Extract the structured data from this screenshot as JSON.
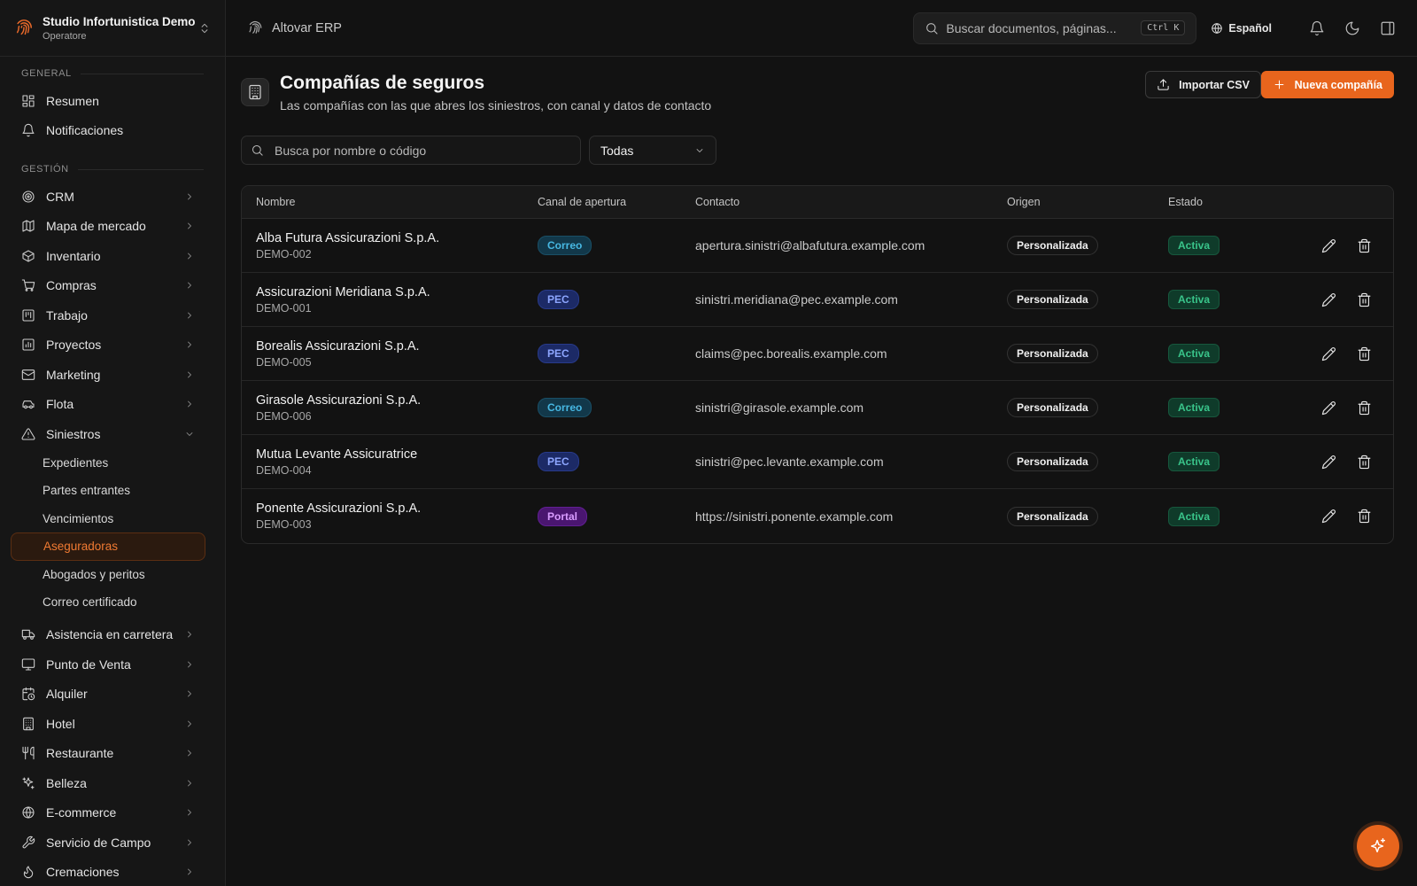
{
  "workspace": {
    "name": "Studio Infortunistica Demo",
    "role": "Operatore"
  },
  "topbar": {
    "app_title": "Altovar ERP",
    "search_placeholder": "Buscar documentos, páginas...",
    "shortcut": "Ctrl K",
    "language": "Español"
  },
  "sidebar": {
    "sections": [
      {
        "label": "GENERAL"
      },
      {
        "label": "GESTIÓN"
      }
    ],
    "general_items": [
      {
        "label": "Resumen",
        "icon": "dashboard-icon"
      },
      {
        "label": "Notificaciones",
        "icon": "bell-icon"
      }
    ],
    "gestion_items": [
      {
        "label": "CRM",
        "icon": "target-icon"
      },
      {
        "label": "Mapa de mercado",
        "icon": "map-icon"
      },
      {
        "label": "Inventario",
        "icon": "box-icon"
      },
      {
        "label": "Compras",
        "icon": "cart-icon"
      },
      {
        "label": "Trabajo",
        "icon": "kanban-icon"
      },
      {
        "label": "Proyectos",
        "icon": "chart-icon"
      },
      {
        "label": "Marketing",
        "icon": "mail-icon"
      },
      {
        "label": "Flota",
        "icon": "car-icon"
      },
      {
        "label": "Siniestros",
        "icon": "warning-icon"
      }
    ],
    "siniestros_sub": [
      {
        "label": "Expedientes"
      },
      {
        "label": "Partes entrantes"
      },
      {
        "label": "Vencimientos"
      },
      {
        "label": "Aseguradoras",
        "active": true
      },
      {
        "label": "Abogados y peritos"
      },
      {
        "label": "Correo certificado"
      }
    ],
    "more_items": [
      {
        "label": "Asistencia en carretera",
        "icon": "truck-icon"
      },
      {
        "label": "Punto de Venta",
        "icon": "monitor-icon"
      },
      {
        "label": "Alquiler",
        "icon": "calendar-clock-icon"
      },
      {
        "label": "Hotel",
        "icon": "building-icon"
      },
      {
        "label": "Restaurante",
        "icon": "utensils-icon"
      },
      {
        "label": "Belleza",
        "icon": "sparkles-icon"
      },
      {
        "label": "E-commerce",
        "icon": "globe-icon"
      },
      {
        "label": "Servicio de Campo",
        "icon": "wrench-icon"
      },
      {
        "label": "Cremaciones",
        "icon": "flame-icon"
      }
    ]
  },
  "page": {
    "title": "Compañías de seguros",
    "subtitle": "Las compañías con las que abres los siniestros, con canal y datos de contacto",
    "import_label": "Importar CSV",
    "new_label": "Nueva compañía",
    "filter_placeholder": "Busca por nombre o código",
    "filter_value": "Todas"
  },
  "table": {
    "headers": [
      "Nombre",
      "Canal de apertura",
      "Contacto",
      "Origen",
      "Estado"
    ],
    "rows": [
      {
        "name": "Alba Futura Assicurazioni S.p.A.",
        "code": "DEMO-002",
        "channel": "Correo",
        "contact": "apertura.sinistri@albafutura.example.com",
        "origin": "Personalizada",
        "state": "Activa"
      },
      {
        "name": "Assicurazioni Meridiana S.p.A.",
        "code": "DEMO-001",
        "channel": "PEC",
        "contact": "sinistri.meridiana@pec.example.com",
        "origin": "Personalizada",
        "state": "Activa"
      },
      {
        "name": "Borealis Assicurazioni S.p.A.",
        "code": "DEMO-005",
        "channel": "PEC",
        "contact": "claims@pec.borealis.example.com",
        "origin": "Personalizada",
        "state": "Activa"
      },
      {
        "name": "Girasole Assicurazioni S.p.A.",
        "code": "DEMO-006",
        "channel": "Correo",
        "contact": "sinistri@girasole.example.com",
        "origin": "Personalizada",
        "state": "Activa"
      },
      {
        "name": "Mutua Levante Assicuratrice",
        "code": "DEMO-004",
        "channel": "PEC",
        "contact": "sinistri@pec.levante.example.com",
        "origin": "Personalizada",
        "state": "Activa"
      },
      {
        "name": "Ponente Assicurazioni S.p.A.",
        "code": "DEMO-003",
        "channel": "Portal",
        "contact": "https://sinistri.ponente.example.com",
        "origin": "Personalizada",
        "state": "Activa"
      }
    ]
  },
  "colors": {
    "accent": "#e8651d",
    "active_status": "#39c48a"
  }
}
